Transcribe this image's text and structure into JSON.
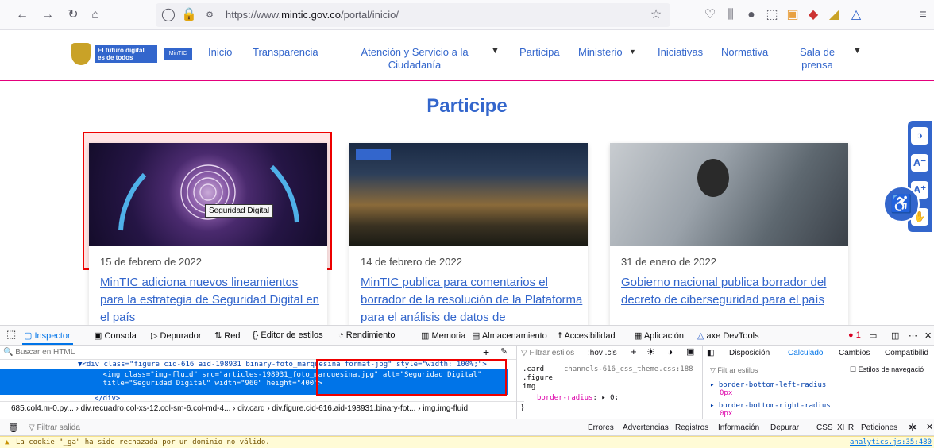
{
  "browser": {
    "url_prefix": "https://www.",
    "url_domain": "mintic.gov.co",
    "url_path": "/portal/inicio/"
  },
  "site": {
    "gov_line1": "El futuro digital",
    "gov_line2": "es de todos",
    "badge": "MinTIC",
    "nav": [
      "Inicio",
      "Transparencia",
      "Atención y Servicio a la Ciudadanía",
      "Participa",
      "Ministerio",
      "Iniciativas",
      "Normativa",
      "Sala de prensa"
    ]
  },
  "page": {
    "title": "Participe",
    "tooltip": "Seguridad Digital",
    "cards": [
      {
        "date": "15 de febrero de 2022",
        "title": "MinTIC adiciona nuevos lineamientos para la estrategia de Seguridad Digital en el país"
      },
      {
        "date": "14 de febrero de 2022",
        "title": "MinTIC publica para comentarios el borrador de la resolución de la Plataforma para el análisis de datos de"
      },
      {
        "date": "31 de enero de 2022",
        "title": "Gobierno nacional publica borrador del decreto de ciberseguridad para el país"
      }
    ]
  },
  "devtools": {
    "tabs": [
      "Inspector",
      "Consola",
      "Depurador",
      "Red",
      "Editor de estilos",
      "Rendimiento",
      "Memoria",
      "Almacenamiento",
      "Accesibilidad",
      "Aplicación",
      "axe DevTools"
    ],
    "search_placeholder": "Buscar en HTML",
    "markup_line1": "▼<div class=\"figure cid-616 aid-198931 binary-foto_marquesina format-jpg\" style=\"width: 100%;\">",
    "markup_line2": "    <img class=\"img-fluid\" src=\"articles-198931_foto_marquesina.jpg\" alt=\"Seguridad Digital\"",
    "markup_line3": "    title=\"Seguridad Digital\" width=\"960\" height=\"400\">",
    "markup_line4": "  </div>",
    "breadcrumb": "685.col4.m-0.py...  ›  div.recuadro.col-xs-12.col-sm-6.col-md-4...  ›  div.card  ›  div.figure.cid-616.aid-198931.binary-fot...  ›  img.img-fluid",
    "styles_filter": "Filtrar estilos",
    "styles_toggles": ":hov  .cls",
    "rule_selector": ".card\n.figure\nimg",
    "rule_source": "channels-616_css_theme.css:188",
    "rule_prop": "border-radius",
    "rule_val": "0",
    "layout_tabs": [
      "Disposición",
      "Calculado",
      "Cambios",
      "Compatibilid"
    ],
    "computed_filter": "Filtrar estilos",
    "browser_styles": "Estilos de navegació",
    "computed_props": [
      "border-bottom-left-radius",
      "0px",
      "border-bottom-right-radius",
      "0px"
    ],
    "console_filter": "Filtrar salida",
    "console_levels": [
      "Errores",
      "Advertencias",
      "Registros",
      "Información",
      "Depurar",
      "CSS",
      "XHR",
      "Peticiones"
    ],
    "warning": "La cookie \"_ga\" ha sido rechazada por un dominio no válido.",
    "warning_src": "analytics.js:35:480",
    "error_count": "1"
  },
  "colors": {
    "brand": "#3366cc",
    "accent": "#e4007c",
    "highlight": "#ee0000",
    "devtools_select": "#0074e8"
  }
}
